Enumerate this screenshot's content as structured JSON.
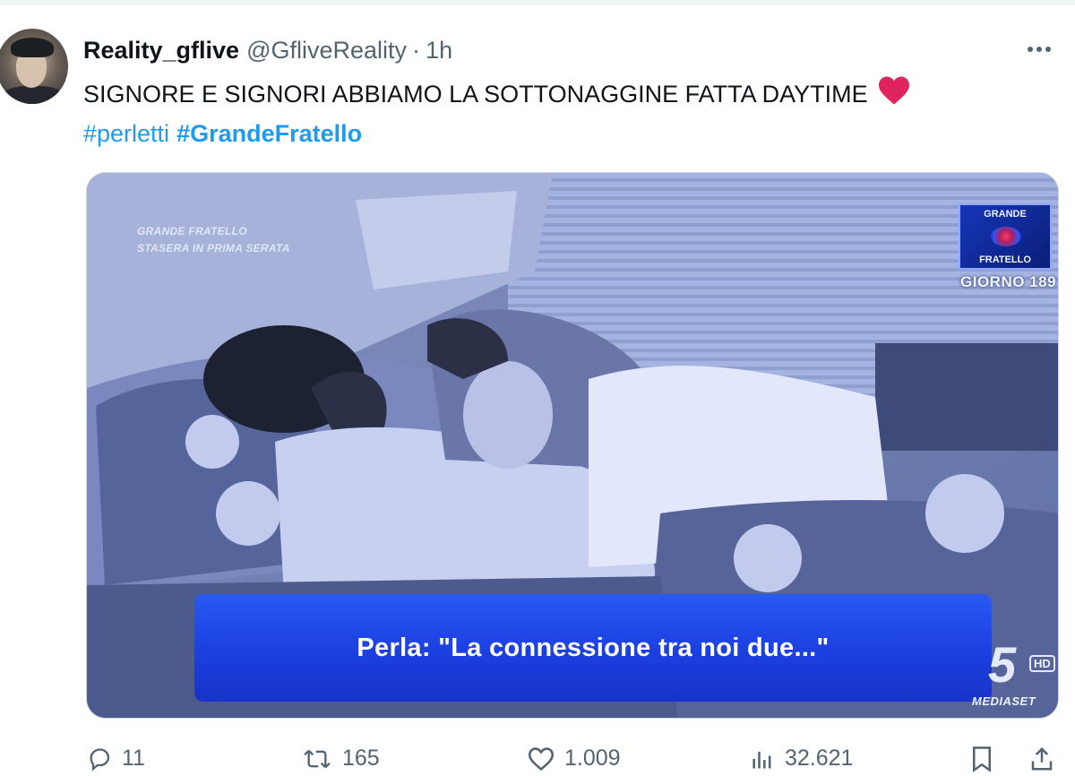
{
  "tweet": {
    "display_name": "Reality_gflive",
    "handle": "@GfliveReality",
    "separator": "·",
    "time": "1h",
    "text": "SIGNORE E SIGNORI ABBIAMO LA SOTTONAGGINE FATTA DAYTIME",
    "hashtags": [
      "#perletti",
      "#GrandeFratello"
    ]
  },
  "media": {
    "watermark": [
      "GRANDE FRATELLO",
      "STASERA IN PRIMA SERATA"
    ],
    "logo_top": "GRANDE",
    "logo_bottom": "FRATELLO",
    "day": "GIORNO 189",
    "caption": "Perla: \"La connessione tra noi due...\"",
    "channel_number": "5",
    "channel_hd": "HD",
    "channel_brand": "MEDIASET"
  },
  "actions": {
    "replies": "11",
    "retweets": "165",
    "likes": "1.009",
    "views": "32.621"
  },
  "colors": {
    "accent": "#1d9bf0",
    "muted": "#536471",
    "heart": "#e0245e",
    "caption_bg": "#1b3fe0"
  }
}
